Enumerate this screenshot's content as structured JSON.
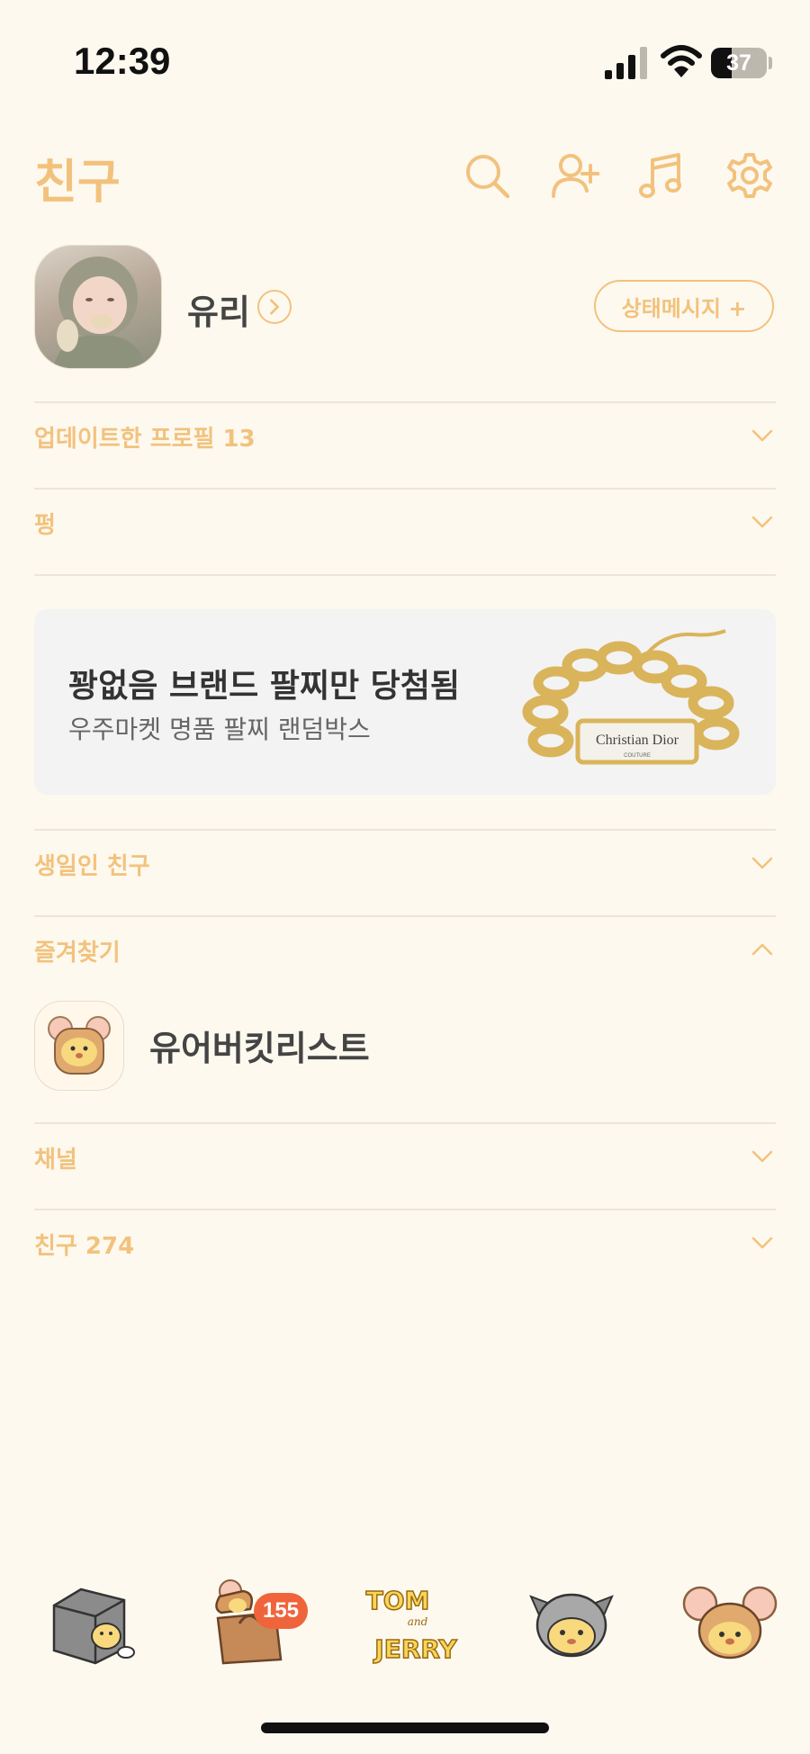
{
  "status_bar": {
    "time": "12:39",
    "battery": "37",
    "battery_level": 0.37
  },
  "header": {
    "title": "친구",
    "icons": [
      "search-icon",
      "add-friend-icon",
      "music-icon",
      "settings-icon"
    ]
  },
  "profile": {
    "name": "유리",
    "status_button": "상태메시지 +"
  },
  "sections": {
    "updated_profiles": "업데이트한 프로필 13",
    "pung": "펑",
    "birthday": "생일인 친구",
    "favorites": "즐겨찾기",
    "channels": "채널",
    "friends": "친구 274"
  },
  "ad": {
    "title": "꽝없음 브랜드 팔찌만 당첨됨",
    "subtitle": "우주마켓 명품 팔찌 랜덤박스",
    "image_text": "Christian Dior",
    "image_subtext": "COUTURE"
  },
  "favorites": [
    {
      "name": "유어버킷리스트"
    }
  ],
  "tabbar": {
    "items": [
      "tab-friends",
      "tab-chats",
      "tab-view",
      "tab-shopping",
      "tab-more"
    ],
    "logo_top": "TOM",
    "logo_mid": "and",
    "logo_bottom": "JERRY",
    "chat_badge": "155"
  },
  "colors": {
    "accent": "#f2c27d",
    "background": "#fdf9ef",
    "badge": "#f0643b"
  }
}
